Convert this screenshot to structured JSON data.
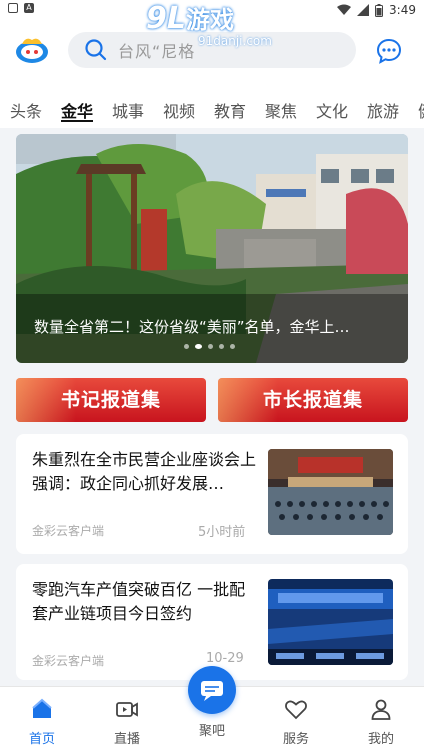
{
  "status_bar": {
    "time": "3:49"
  },
  "watermark": {
    "brand_num": "9L",
    "brand_cn": "游戏",
    "site": "91danji.com"
  },
  "search": {
    "placeholder": "台风“尼格"
  },
  "tabs": [
    "头条",
    "金华",
    "城事",
    "视频",
    "教育",
    "聚焦",
    "文化",
    "旅游",
    "健"
  ],
  "active_tab": "金华",
  "banner": {
    "caption": "数量全省第二！这份省级“美丽”名单，金华上…",
    "slide_count": 5,
    "active_slide": 2
  },
  "quick_links": [
    "书记报道集",
    "市长报道集"
  ],
  "news": [
    {
      "title": "朱重烈在全市民营企业座谈会上强调：政企同心抓好发展…",
      "source": "金彩云客户端",
      "time": "5小时前"
    },
    {
      "title": "零跑汽车产值突破百亿  一批配套产业链项目今日签约",
      "source": "金彩云客户端",
      "time": "10-29"
    }
  ],
  "nav": {
    "home": "首页",
    "live": "直播",
    "center": "聚吧",
    "service": "服务",
    "mine": "我的"
  },
  "colors": {
    "accent": "#1a73e8",
    "red": "#d3202a"
  }
}
